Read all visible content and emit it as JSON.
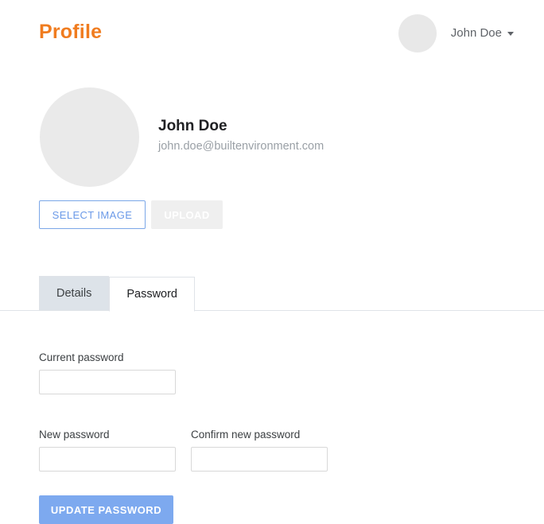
{
  "header": {
    "title": "Profile",
    "title_color": "#f07c1f",
    "user": {
      "name": "John Doe",
      "avatar_icon": "user-avatar-placeholder",
      "caret_icon": "caret-down-icon"
    }
  },
  "profile": {
    "avatar_icon": "profile-avatar-placeholder",
    "name": "John Doe",
    "email": "john.doe@builtenvironment.com",
    "actions": {
      "select_image_label": "SELECT IMAGE",
      "upload_label": "UPLOAD"
    }
  },
  "tabs": [
    {
      "label": "Details",
      "active": false
    },
    {
      "label": "Password",
      "active": true
    }
  ],
  "password_form": {
    "current_password": {
      "label": "Current password",
      "value": "",
      "placeholder": ""
    },
    "new_password": {
      "label": "New password",
      "value": "",
      "placeholder": ""
    },
    "confirm_new_password": {
      "label": "Confirm new password",
      "value": "",
      "placeholder": ""
    },
    "submit_label": "UPDATE PASSWORD"
  },
  "colors": {
    "accent_orange": "#f07c1f",
    "primary_blue": "#7da9ef",
    "link_blue": "#6b9ae8",
    "disabled_gray": "#efefef",
    "tab_inactive_bg": "#dde3e9",
    "border_gray": "#dfe3e8"
  }
}
